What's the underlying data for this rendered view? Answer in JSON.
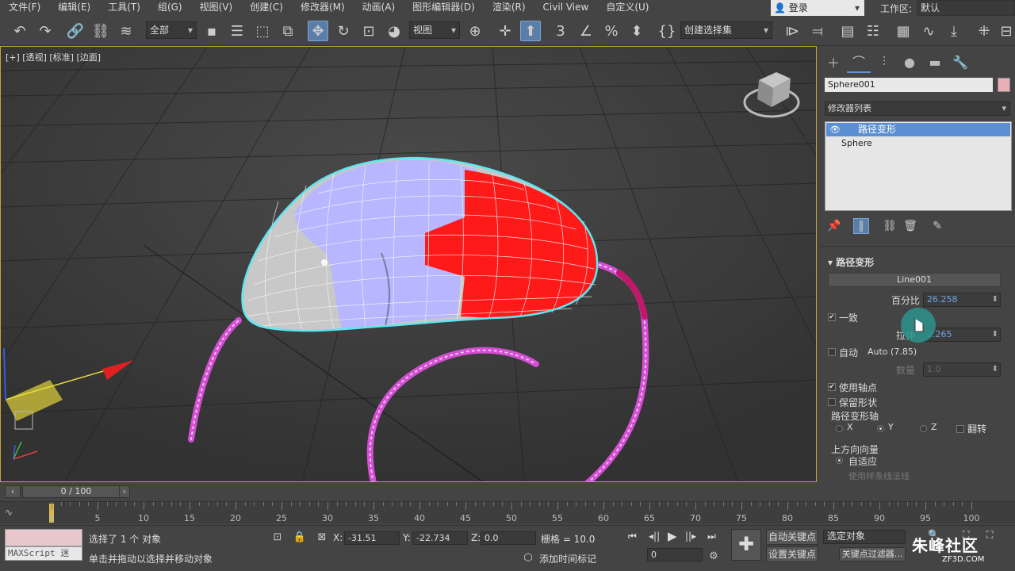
{
  "menu": [
    "文件(F)",
    "编辑(E)",
    "工具(T)",
    "组(G)",
    "视图(V)",
    "创建(C)",
    "修改器(M)",
    "动画(A)",
    "图形编辑器(D)",
    "渲染(R)",
    "Civil View",
    "自定义(U)"
  ],
  "login_label": "登录",
  "workspace_label": "工作区:",
  "workspace_value": "默认",
  "toolbar": {
    "filter_select": "全部",
    "ref_coord_select": "视图",
    "selection_set_select": "创建选择集"
  },
  "viewport": {
    "label": "[+] [透视] [标准] [边面]"
  },
  "command_panel": {
    "object_name": "Sphere001",
    "modifier_list_label": "修改器列表",
    "stack": [
      "路径变形",
      "Sphere"
    ],
    "rollout_title": "路径变形",
    "pick_path_button": "Line001",
    "percent_label": "百分比",
    "percent_value": "26.258",
    "uniform_label": "一致",
    "stretch_label": "拉伸",
    "stretch_value": "2.265",
    "auto_label": "自动",
    "auto_value": "Auto (7.85)",
    "count_label": "数量",
    "count_value": "1.0",
    "use_pivot_label": "使用轴点",
    "preserve_shape_label": "保留形状",
    "path_axis_label": "路径变形轴",
    "axis_x": "X",
    "axis_y": "Y",
    "axis_z": "Z",
    "flip_label": "翻转",
    "up_vector_label": "上方向向量",
    "adaptive_label": "自适应",
    "use_spline_normal_label": "使用样条线法线"
  },
  "timeline": {
    "frame_display": "0 / 100",
    "ticks": [
      "0",
      "5",
      "10",
      "15",
      "20",
      "25",
      "30",
      "35",
      "40",
      "45",
      "50",
      "55",
      "60",
      "65",
      "70",
      "75",
      "80",
      "85",
      "90",
      "95",
      "100"
    ]
  },
  "status": {
    "maxscript_label": "MAXScript 迷",
    "selected_text": "选择了 1 个 对象",
    "hint_text": "单击并拖动以选择并移动对象",
    "x_label": "X:",
    "x_value": "-31.51",
    "y_label": "Y:",
    "y_value": "-22.734",
    "z_label": "Z:",
    "z_value": "0.0",
    "grid_text": "栅格 = 10.0",
    "add_time_tag": "添加时间标记",
    "auto_key": "自动关键点",
    "set_key": "设置关键点",
    "selected_object": "选定对象",
    "key_filters": "关键点过滤器...",
    "frame_value": "0"
  },
  "watermark": {
    "brand": "朱峰社区",
    "url": "ZF3D.COM"
  },
  "colors": {
    "accent_blue": "#5b8fd4",
    "viewport_border": "#c8a13a",
    "object_color": "#e8b0b6",
    "path_line": "#d44fd4",
    "red_faces": "#ff1a1a",
    "lavender_faces": "#b7b6ff",
    "selection_outline": "#5fe6f0"
  }
}
